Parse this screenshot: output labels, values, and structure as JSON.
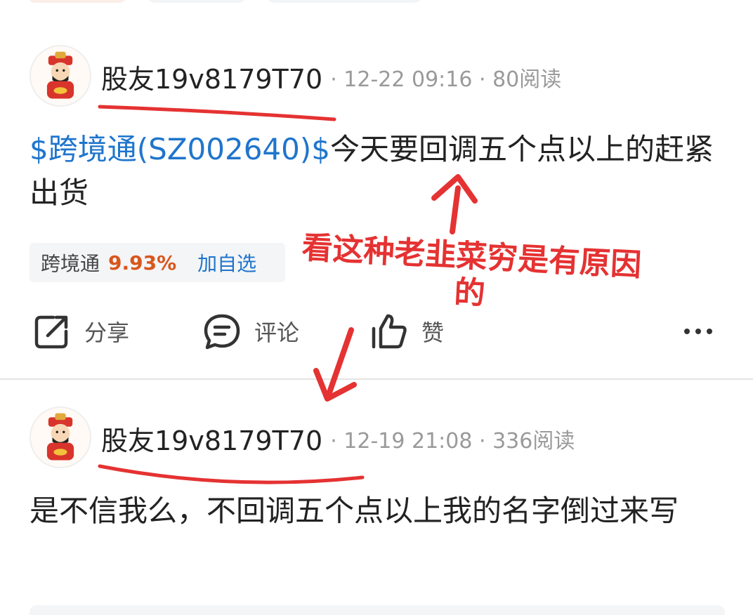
{
  "posts": [
    {
      "username": "股友19v8179T70",
      "meta": "· 12-22 09:16 · 80阅读",
      "stock_link": "$跨境通(SZ002640)$",
      "text": "今天要回调五个点以上的赶紧出货",
      "stock_tag": {
        "name": "跨境通",
        "change": "9.93%",
        "add_label": "加自选"
      },
      "actions": {
        "share": "分享",
        "comment": "评论",
        "like": "赞"
      }
    },
    {
      "username": "股友19v8179T70",
      "meta": "· 12-19 21:08 · 336阅读",
      "text": "是不信我么，不回调五个点以上我的名字倒过来写"
    }
  ],
  "annotation": {
    "text": "看这种老韭菜穷是有原因的",
    "color": "#e53232"
  },
  "colors": {
    "link": "#1f75cc",
    "gain": "#d9561c",
    "muted": "#9a9a9a"
  },
  "icons": [
    "avatar-caishen",
    "share-icon",
    "comment-icon",
    "like-icon",
    "more-icon"
  ]
}
